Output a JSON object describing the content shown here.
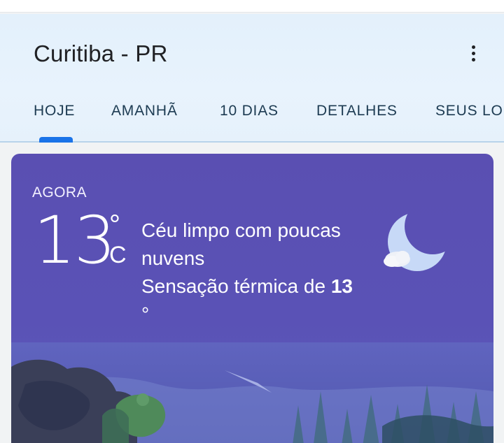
{
  "header": {
    "city": "Curitiba - PR",
    "more_icon": "more-vert-icon"
  },
  "tabs": [
    {
      "label": "HOJE",
      "selected": true
    },
    {
      "label": "AMANHÃ",
      "selected": false
    },
    {
      "label": "10 DIAS",
      "selected": false
    },
    {
      "label": "DETALHES",
      "selected": false
    },
    {
      "label": "SEUS LO",
      "selected": false
    }
  ],
  "current": {
    "label": "AGORA",
    "temperature": "13",
    "degree": "°",
    "unit": "C",
    "condition": "Céu limpo com poucas nuvens",
    "feels_prefix": "Sensação térmica de",
    "feels_value": "13",
    "feels_unit": "°",
    "icon": "moon-cloud-icon"
  },
  "colors": {
    "accent": "#1a73e8",
    "card_background": "#5a50b4",
    "header_background": "#e6f1fb"
  }
}
